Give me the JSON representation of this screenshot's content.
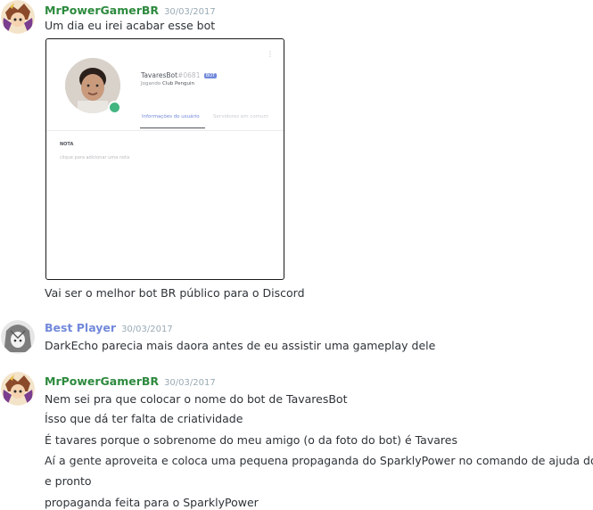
{
  "messages": [
    {
      "username": "MrPowerGamerBR",
      "username_color": "#2d8a3e",
      "timestamp": "30/03/2017",
      "lines_before": [
        "Um dia eu irei acabar esse bot"
      ],
      "embed": {
        "bot_name": "TavaresBot",
        "discriminator": "#0681",
        "badge": "BOT",
        "playing_prefix": "Jogando",
        "playing_game": "Club Penguin",
        "tab_active": "Informações do usuário",
        "tab_other": "Servidores em comum",
        "note_heading": "NOTA",
        "note_placeholder": "clique para adicionar uma nota",
        "status_color": "#43b581"
      },
      "lines_after": [
        "Vai ser o melhor bot BR público para o Discord"
      ]
    },
    {
      "username": "Best Player",
      "username_color": "#7289da",
      "timestamp": "30/03/2017",
      "lines": [
        "DarkEcho parecia mais daora antes de eu assistir uma gameplay dele"
      ]
    },
    {
      "username": "MrPowerGamerBR",
      "username_color": "#2d8a3e",
      "timestamp": "30/03/2017",
      "lines": [
        "Nem sei pra que colocar o nome do bot de TavaresBot",
        "Ísso que dá ter falta de criatividade",
        "É tavares porque o sobrenome do meu amigo (o da foto do bot) é Tavares",
        "Aí a gente aproveita e coloca uma pequena propaganda do SparklyPower no comando de ajuda do bot",
        "e pronto",
        "propaganda feita para o SparklyPower"
      ]
    }
  ]
}
